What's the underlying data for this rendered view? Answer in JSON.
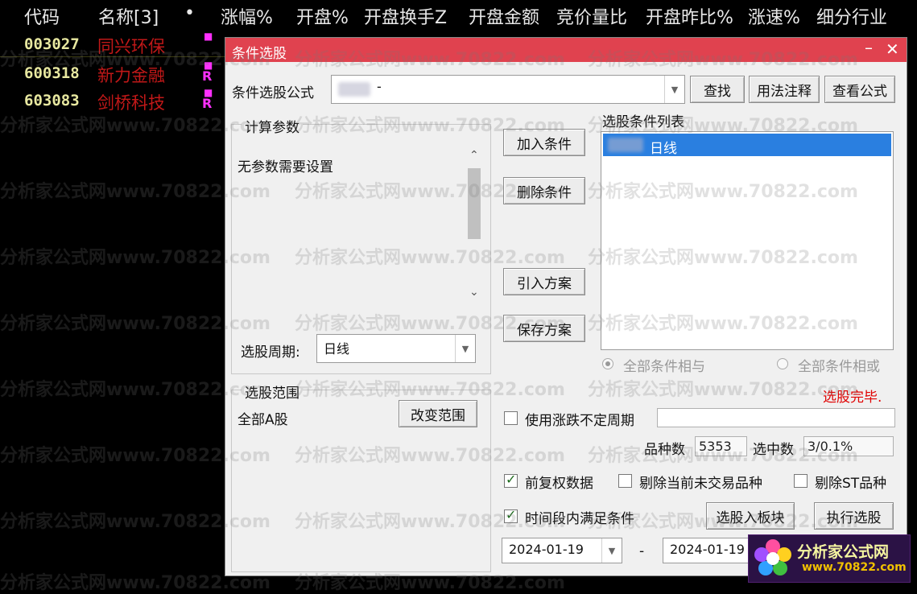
{
  "header": {
    "cols": [
      "代码",
      "名称[3]",
      "•",
      "涨幅%",
      "开盘%",
      "开盘换手Z",
      "开盘金额",
      "竞价量比",
      "开盘昨比%",
      "涨速%",
      "细分行业"
    ]
  },
  "rows": [
    {
      "code": "003027",
      "name": "同兴环保",
      "mark": ""
    },
    {
      "code": "600318",
      "name": "新力金融",
      "mark": "R"
    },
    {
      "code": "603083",
      "name": "剑桥科技",
      "mark": "R"
    }
  ],
  "watermark": "分析家公式网www.70822.com",
  "dialog": {
    "title": "条件选股",
    "close_icon": "close-icon",
    "formula_label": "条件选股公式",
    "formula_value": "-",
    "find": "查找",
    "usage_note": "用法注释",
    "view_formula": "查看公式",
    "params_caption": "计算参数",
    "no_params": "无参数需要设置",
    "add_condition": "加入条件",
    "delete_condition": "删除条件",
    "import_plan": "引入方案",
    "save_plan": "保存方案",
    "conditions_label": "选股条件列表",
    "conditions": [
      "日线"
    ],
    "period_label": "选股周期:",
    "period_value": "日线",
    "radio_and": "全部条件相与",
    "radio_or": "全部条件相或",
    "done": "选股完毕.",
    "range_caption": "选股范围",
    "range_value": "全部A股",
    "change_range": "改变范围",
    "use_uncertain_period": "使用涨跌不定周期",
    "count_label": "品种数",
    "count_value": "5353",
    "selected_label": "选中数",
    "selected_value": "3/0.1%",
    "pre_adjusted": "前复权数据",
    "remove_untraded": "剔除当前未交易品种",
    "remove_st": "剔除ST品种",
    "time_range": "时间段内满足条件",
    "to_block": "选股入板块",
    "execute": "执行选股",
    "date_from": "2024-01-19",
    "date_sep": "-",
    "date_to": "2024-01-19"
  },
  "logo": {
    "line1": "分析家公式网",
    "line2": "www.70822.com"
  },
  "colors": {
    "title_bar": "#e0424f",
    "selection": "#2a7fe0",
    "done_text": "#e00000"
  }
}
